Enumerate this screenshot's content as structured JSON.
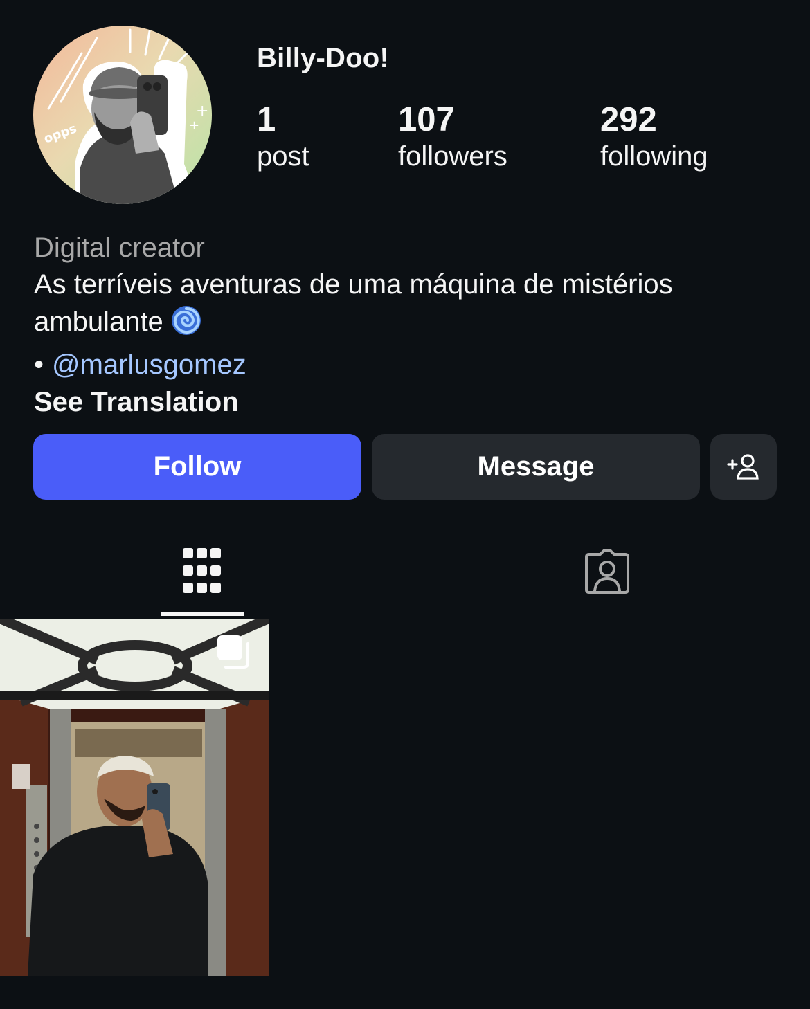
{
  "profile": {
    "username": "Billy-Doo!",
    "stats": {
      "posts": {
        "count": "1",
        "label": "post"
      },
      "followers": {
        "count": "107",
        "label": "followers"
      },
      "following": {
        "count": "292",
        "label": "following"
      }
    },
    "avatar_sticker_text": "opps"
  },
  "bio": {
    "category": "Digital creator",
    "line1": "As terríveis aventuras de uma máquina de mistérios",
    "line2": "ambulante",
    "bullet": "•",
    "mention": "@marlusgomez",
    "see_translation": "See Translation"
  },
  "actions": {
    "follow_label": "Follow",
    "message_label": "Message",
    "add_icon": "add-person-icon"
  },
  "tabs": [
    {
      "icon": "grid-icon",
      "active": true
    },
    {
      "icon": "tagged-person-icon",
      "active": false
    }
  ],
  "colors": {
    "background": "#0c1014",
    "follow_button": "#4a5df9",
    "secondary_button": "#25292e",
    "mention": "#a5c7ff",
    "muted_text": "#a8a8a8"
  },
  "posts": [
    {
      "type": "carousel",
      "icon": "carousel-icon"
    }
  ]
}
